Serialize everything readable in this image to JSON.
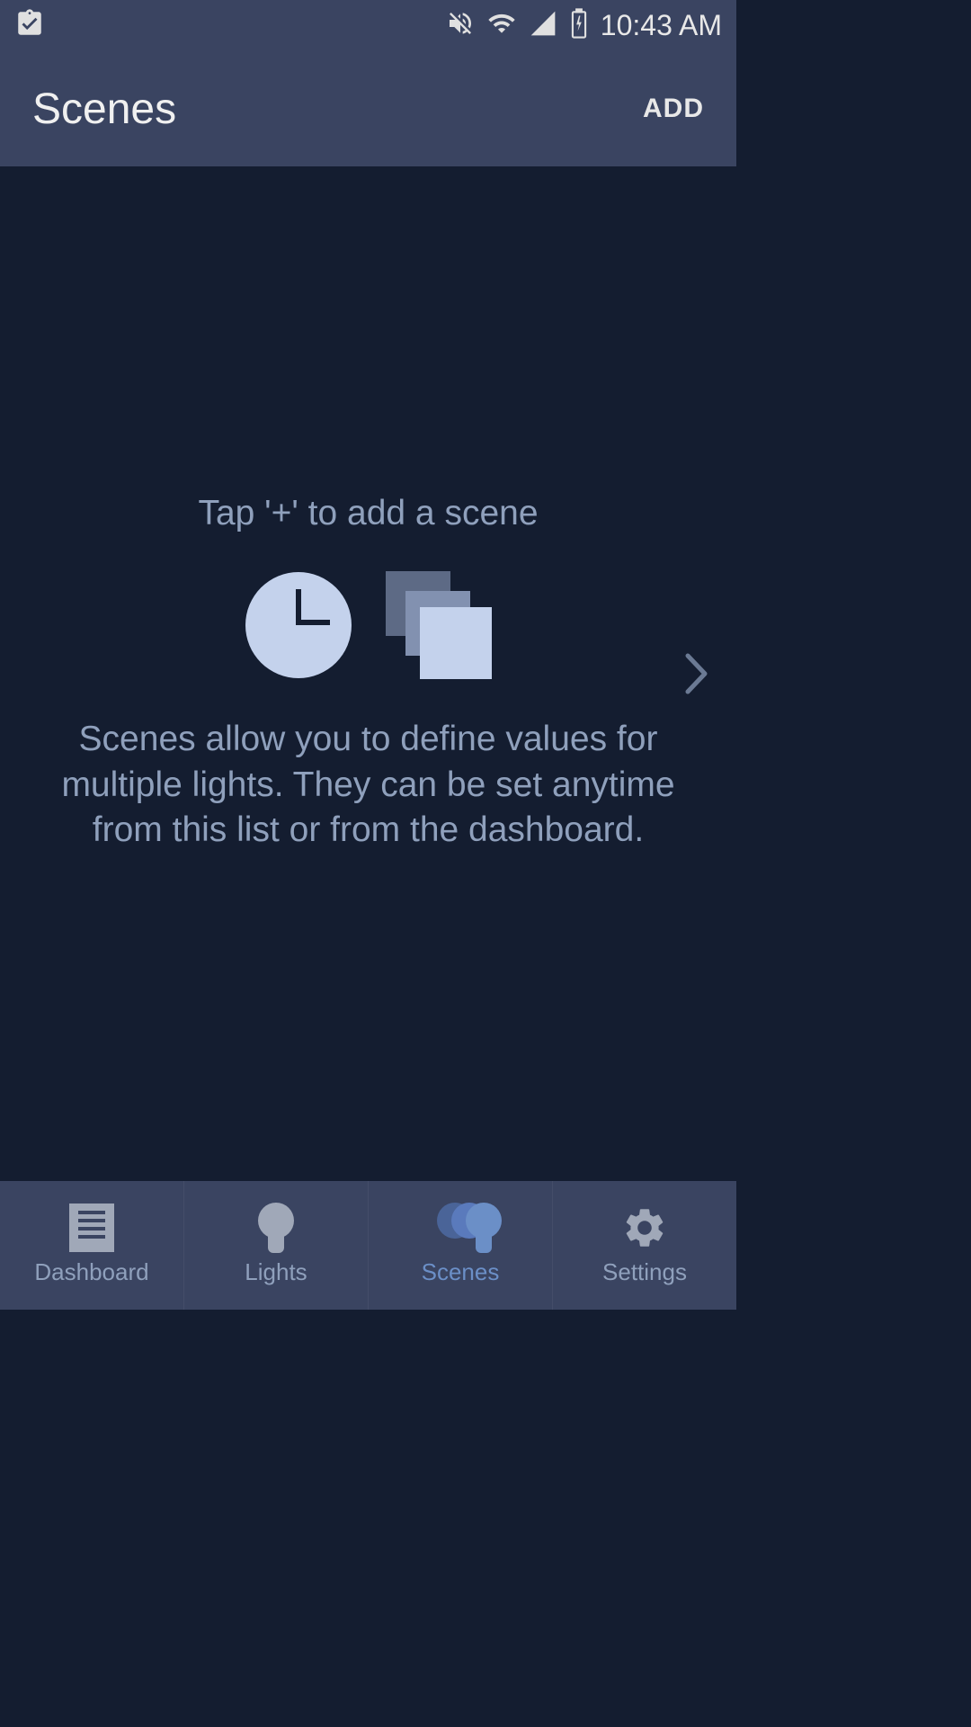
{
  "status_bar": {
    "time": "10:43 AM"
  },
  "app_bar": {
    "title": "Scenes",
    "add_label": "ADD"
  },
  "empty_state": {
    "title": "Tap '+' to add a scene",
    "description": "Scenes allow you to define values for multiple lights. They can be set anytime from this list or from the dashboard."
  },
  "bottom_nav": {
    "items": [
      {
        "label": "Dashboard",
        "active": false
      },
      {
        "label": "Lights",
        "active": false
      },
      {
        "label": "Scenes",
        "active": true
      },
      {
        "label": "Settings",
        "active": false
      }
    ]
  }
}
